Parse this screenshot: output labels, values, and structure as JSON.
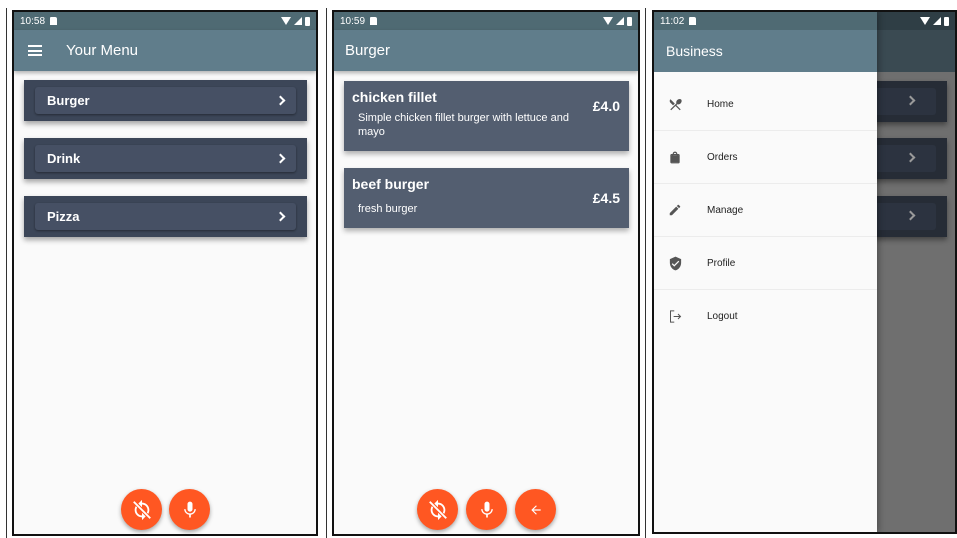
{
  "screen1": {
    "status_time": "10:58",
    "title": "Your Menu",
    "categories": [
      {
        "label": "Burger"
      },
      {
        "label": "Drink"
      },
      {
        "label": "Pizza"
      }
    ]
  },
  "screen2": {
    "status_time": "10:59",
    "title": "Burger",
    "items": [
      {
        "name": "chicken fillet",
        "description": "Simple chicken fillet burger with lettuce and mayo",
        "price": "£4.0"
      },
      {
        "name": "beef burger",
        "description": "fresh burger",
        "price": "£4.5"
      }
    ]
  },
  "screen3": {
    "status_time": "11:02",
    "drawer_title": "Business",
    "drawer_items": [
      {
        "label": "Home",
        "icon": "utensils-icon"
      },
      {
        "label": "Orders",
        "icon": "shopping-bag-icon"
      },
      {
        "label": "Manage",
        "icon": "pencil-icon"
      },
      {
        "label": "Profile",
        "icon": "shield-check-icon"
      },
      {
        "label": "Logout",
        "icon": "logout-icon"
      }
    ]
  },
  "colors": {
    "status_bar": "#4f6a73",
    "app_bar": "#607d8b",
    "card_dark": "#3c4658",
    "card_food": "#535e70",
    "fab": "#ff5722"
  }
}
